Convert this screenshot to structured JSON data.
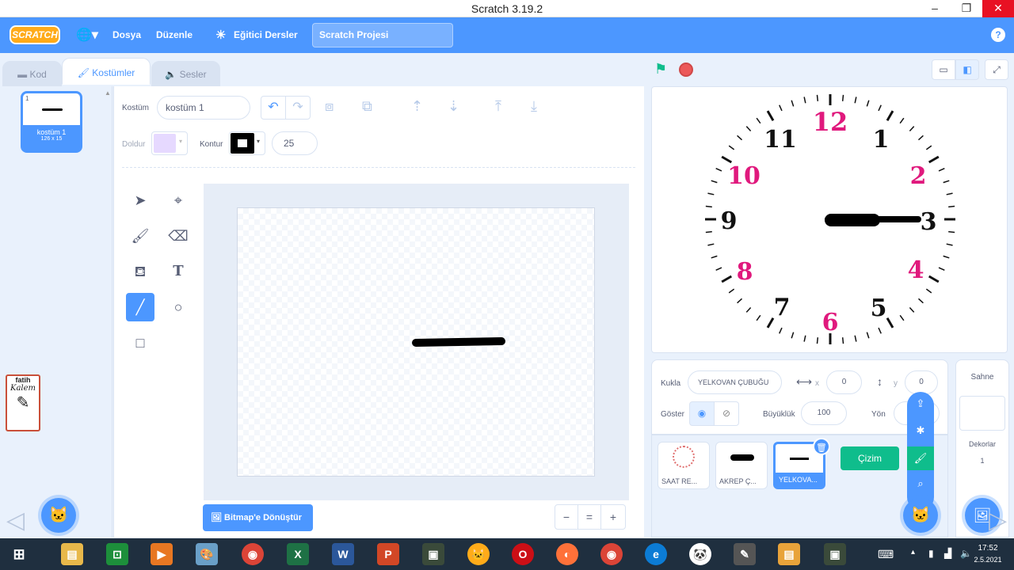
{
  "window": {
    "title": "Scratch 3.19.2"
  },
  "menubar": {
    "logo": "SCRATCH",
    "file": "Dosya",
    "edit": "Düzenle",
    "tutorials": "Eğitici Dersler",
    "project_title": "Scratch Projesi",
    "help": "?"
  },
  "tabs": {
    "code": "Kod",
    "costumes": "Kostümler",
    "sounds": "Sesler"
  },
  "costume_list": {
    "items": [
      {
        "index": "1",
        "name": "kostüm 1",
        "size": "126 x 15"
      }
    ]
  },
  "editor": {
    "costume_label": "Kostüm",
    "costume_name": "kostüm 1",
    "fill_label": "Doldur",
    "outline_label": "Kontur",
    "outline_width": "25",
    "fill_color": "#e6d9ff",
    "outline_color": "#000000",
    "convert_button": "Bitmap'e Dönüştür",
    "zoom_out": "−",
    "zoom_reset": "=",
    "zoom_in": "+"
  },
  "stage": {
    "clock_numbers": {
      "n12": "12",
      "n1": "1",
      "n2": "2",
      "n3": "3",
      "n4": "4",
      "n5": "5",
      "n6": "6",
      "n7": "7",
      "n8": "8",
      "n9": "9",
      "n10": "10",
      "n11": "11"
    },
    "accent_color": "#e0197d"
  },
  "sprite_info": {
    "sprite_label": "Kukla",
    "sprite_name": "YELKOVAN ÇUBUĞU",
    "x_label": "x",
    "x_value": "0",
    "y_label": "y",
    "y_value": "0",
    "show_label": "Göster",
    "size_label": "Büyüklük",
    "size_value": "100",
    "direction_label": "Yön"
  },
  "sprites": [
    {
      "name": "SAAT RE..."
    },
    {
      "name": "AKREP Ç..."
    },
    {
      "name": "YELKOVA..."
    }
  ],
  "tooltip": "Çizim",
  "stage_pane": {
    "title": "Sahne",
    "backdrops_label": "Dekorlar",
    "backdrops_count": "1"
  },
  "fatih_logo": {
    "line1": "fatih",
    "line2": "Kalem"
  },
  "taskbar": {
    "time": "17:52",
    "date": "2.5.2021"
  }
}
